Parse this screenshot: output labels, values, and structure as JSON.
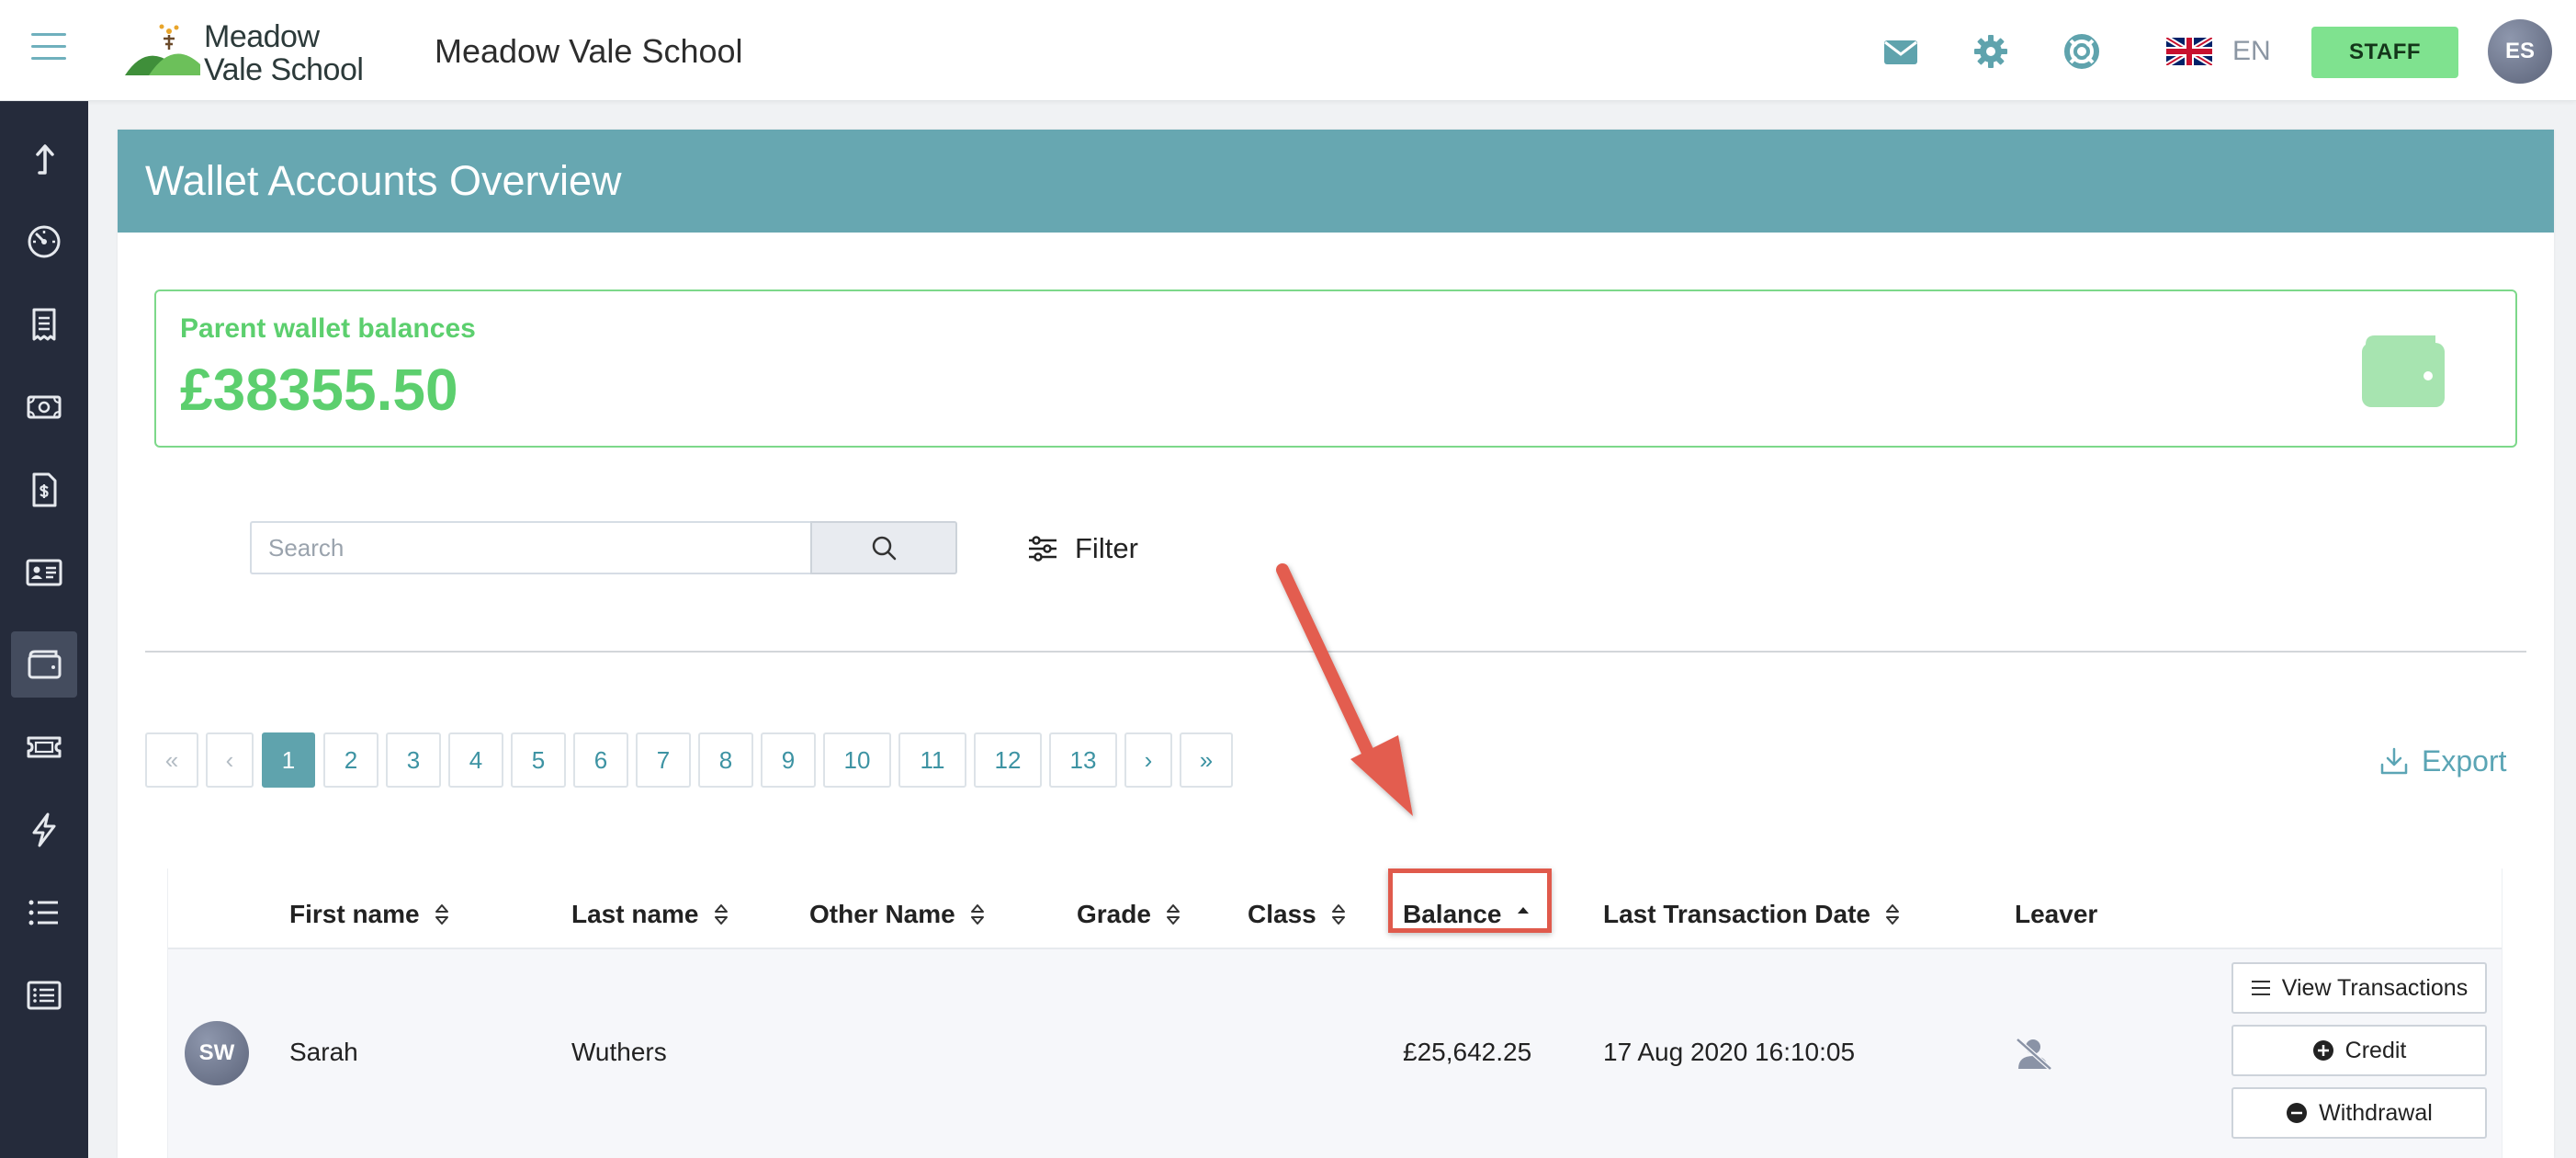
{
  "header": {
    "logo_line1": "Meadow",
    "logo_line2": "Vale School",
    "school_name": "Meadow Vale School",
    "language": "EN",
    "staff_label": "STAFF",
    "user_initials": "ES"
  },
  "colors": {
    "accent": "#67a7b1",
    "success": "#5ccf6e",
    "sidebar": "#252b3b",
    "highlight": "#e05a4c"
  },
  "sidebar": {
    "items": [
      {
        "icon": "upload-arrow-icon"
      },
      {
        "icon": "dashboard-gauge-icon"
      },
      {
        "icon": "receipt-icon"
      },
      {
        "icon": "money-icon"
      },
      {
        "icon": "invoice-dollar-icon"
      },
      {
        "icon": "id-card-icon"
      },
      {
        "icon": "wallet-icon",
        "active": true
      },
      {
        "icon": "ticket-icon"
      },
      {
        "icon": "lightning-icon"
      },
      {
        "icon": "list-icon"
      },
      {
        "icon": "detailed-list-icon"
      }
    ]
  },
  "page": {
    "title": "Wallet Accounts Overview",
    "balance_label": "Parent wallet balances",
    "balance_value": "£38355.50"
  },
  "search": {
    "placeholder": "Search",
    "filter_label": "Filter"
  },
  "pagination": {
    "first": "«",
    "prev": "‹",
    "pages": [
      "1",
      "2",
      "3",
      "4",
      "5",
      "6",
      "7",
      "8",
      "9",
      "10",
      "11",
      "12",
      "13"
    ],
    "current": "1",
    "next": "›",
    "last": "»"
  },
  "export_label": "Export",
  "table": {
    "columns": [
      "First name",
      "Last name",
      "Other Name",
      "Grade",
      "Class",
      "Balance",
      "Last Transaction Date",
      "Leaver"
    ],
    "sorted_column": "Balance",
    "rows": [
      {
        "initials": "SW",
        "first_name": "Sarah",
        "last_name": "Wuthers",
        "other_name": "",
        "grade": "",
        "class": "",
        "balance": "£25,642.25",
        "last_transaction": "17 Aug 2020 16:10:05",
        "leaver_icon": "user-slash-icon"
      }
    ],
    "actions": {
      "view": "View Transactions",
      "credit": "Credit",
      "withdrawal": "Withdrawal"
    }
  }
}
